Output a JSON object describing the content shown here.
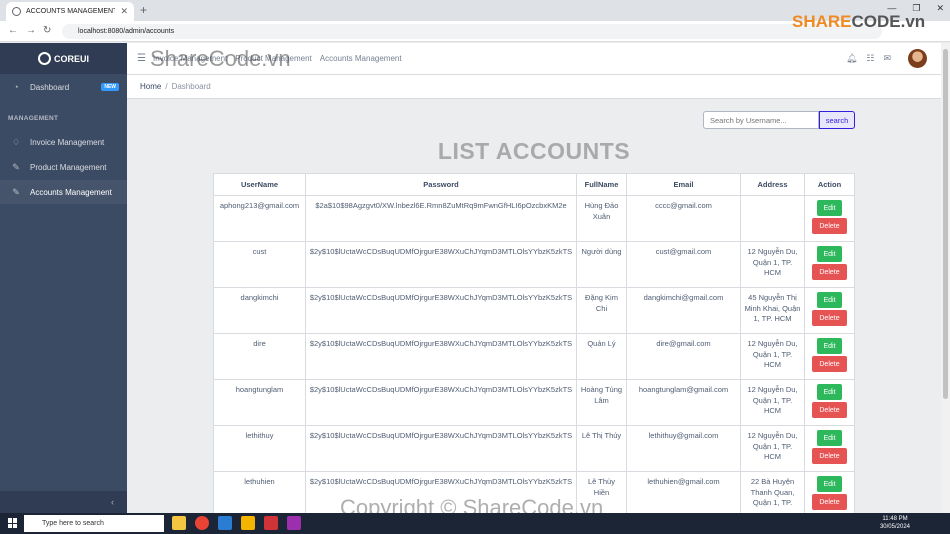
{
  "browser": {
    "tab_title": "ACCOUNTS MANAGEMENT",
    "url": "localhost:8080/admin/accounts"
  },
  "sidebar": {
    "brand": "COREUI",
    "dashboard": {
      "label": "Dashboard",
      "badge": "NEW"
    },
    "section_title": "MANAGEMENT",
    "items": [
      {
        "label": "Invoice Management"
      },
      {
        "label": "Product Management"
      },
      {
        "label": "Accounts Management"
      }
    ]
  },
  "header": {
    "nav": [
      "Invoice Management",
      "Product Management",
      "Accounts Management"
    ]
  },
  "breadcrumb": {
    "home": "Home",
    "current": "Dashboard"
  },
  "search": {
    "placeholder": "Search by Username...",
    "button": "search"
  },
  "page_title": "LIST ACCOUNTS",
  "table": {
    "headers": [
      "UserName",
      "Password",
      "FullName",
      "Email",
      "Address",
      "Action"
    ],
    "edit_label": "Edit",
    "delete_label": "Delete",
    "rows": [
      {
        "username": "aphong213@gmail.com",
        "password": "$2a$10$98Agzgvt0/XW.lnbezl6E.Rmn8ZuMtRq9mFwnGfHLI6pOzcbxKM2e",
        "fullname": "Hùng Đảo Xuân",
        "email": "cccc@gmail.com",
        "address": ""
      },
      {
        "username": "cust",
        "password": "$2y$10$lUctaWcCDsBuqUDMfOjrgurE38WXuChJYqmD3MTLOlsYYbzK5zkTS",
        "fullname": "Người dùng",
        "email": "cust@gmail.com",
        "address": "12 Nguyễn Du, Quận 1, TP. HCM"
      },
      {
        "username": "dangkimchi",
        "password": "$2y$10$lUctaWcCDsBuqUDMfOjrgurE38WXuChJYqmD3MTLOlsYYbzK5zkTS",
        "fullname": "Đặng Kim Chi",
        "email": "dangkimchi@gmail.com",
        "address": "45 Nguyễn Thị Minh Khai, Quận 1, TP. HCM"
      },
      {
        "username": "dire",
        "password": "$2y$10$lUctaWcCDsBuqUDMfOjrgurE38WXuChJYqmD3MTLOlsYYbzK5zkTS",
        "fullname": "Quản Lý",
        "email": "dire@gmail.com",
        "address": "12 Nguyễn Du, Quận 1, TP. HCM"
      },
      {
        "username": "hoangtunglam",
        "password": "$2y$10$lUctaWcCDsBuqUDMfOjrgurE38WXuChJYqmD3MTLOlsYYbzK5zkTS",
        "fullname": "Hoàng Tùng Lâm",
        "email": "hoangtunglam@gmail.com",
        "address": "12 Nguyễn Du, Quận 1, TP. HCM"
      },
      {
        "username": "lethithuy",
        "password": "$2y$10$lUctaWcCDsBuqUDMfOjrgurE38WXuChJYqmD3MTLOlsYYbzK5zkTS",
        "fullname": "Lê Thị Thúy",
        "email": "lethithuy@gmail.com",
        "address": "12 Nguyễn Du, Quận 1, TP. HCM"
      },
      {
        "username": "lethuhien",
        "password": "$2y$10$lUctaWcCDsBuqUDMfOjrgurE38WXuChJYqmD3MTLOlsYYbzK5zkTS",
        "fullname": "Lê Thùy Hiền",
        "email": "lethuhien@gmail.com",
        "address": "22 Bà Huyện Thanh Quan, Quận 1, TP."
      }
    ]
  },
  "taskbar": {
    "search": "Type here to search",
    "time": "11:48 PM",
    "date": "30/05/2024"
  },
  "watermarks": {
    "top_brand": "SHARE",
    "top_brand2": "CODE.vn",
    "middle": "ShareCode.vn",
    "bottom": "Copyright © ShareCode.vn"
  }
}
